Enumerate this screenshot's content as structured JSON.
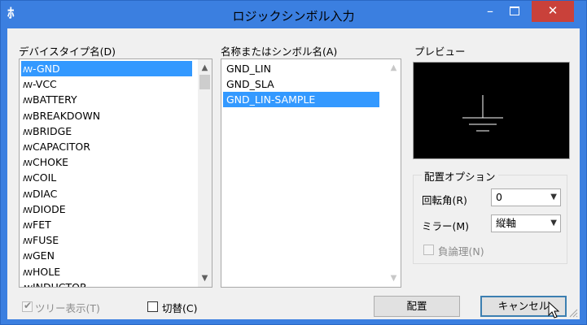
{
  "window": {
    "title": "ロジックシンボル入力",
    "app_icon": "ﾎ",
    "minimize": "–",
    "close": "✕"
  },
  "device_type": {
    "label": "デバイスタイプ名(D)",
    "icon_glyph": "ꟿ",
    "items": [
      "-GND",
      "-VCC",
      "BATTERY",
      "BREAKDOWN",
      "BRIDGE",
      "CAPACITOR",
      "CHOKE",
      "COIL",
      "DIAC",
      "DIODE",
      "FET",
      "FUSE",
      "GEN",
      "HOLE",
      "INDUCTOR"
    ],
    "selected_index": 0
  },
  "symbol_name": {
    "label": "名称またはシンボル名(A)",
    "items": [
      "GND_LIN",
      "GND_SLA",
      "GND_LIN-SAMPLE"
    ],
    "selected_index": 2
  },
  "preview": {
    "label": "プレビュー"
  },
  "placement_options": {
    "label": "配置オプション",
    "rotation_label": "回転角(R)",
    "rotation_value": "0",
    "mirror_label": "ミラー(M)",
    "mirror_value": "縦軸",
    "negative_logic_label": "負論理(N)"
  },
  "bottom": {
    "tree_view_label": "ツリー表示(T)",
    "switch_label": "切替(C)",
    "place_button": "配置",
    "cancel_button": "キャンセル"
  },
  "colors": {
    "title_bar": "#3b7fe0",
    "close_button": "#c9413a",
    "selection": "#3399ff"
  }
}
